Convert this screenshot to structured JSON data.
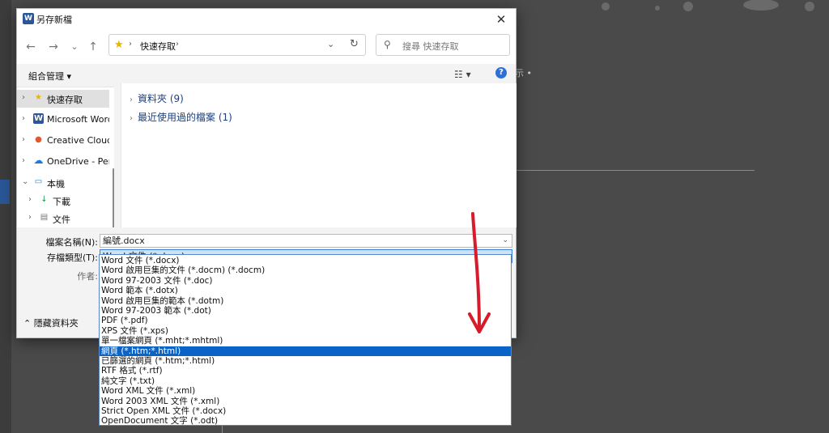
{
  "dialog": {
    "title": "另存新檔",
    "close_glyph": "✕"
  },
  "nav": {
    "back": "←",
    "forward": "→",
    "recent": "⌄",
    "up": "↑",
    "address": {
      "segments": [
        "快速存取"
      ],
      "sep": "›"
    },
    "dropdown_glyph": "⌄",
    "refresh_glyph": "↻",
    "search_placeholder": "搜尋 快速存取"
  },
  "toolbar": {
    "organize": "組合管理 ▾",
    "view_glyph": "☷ ▾",
    "help_glyph": "?"
  },
  "navpane": {
    "items": [
      {
        "label": "快速存取",
        "icon": "★",
        "icon_color": "#e8b400",
        "selected": true
      },
      {
        "label": "Microsoft Word",
        "icon": "W",
        "icon_color": "#2b579a",
        "selected": false
      },
      {
        "label": "Creative Cloud Fi",
        "icon": "●",
        "icon_color": "#e15a2a",
        "selected": false
      },
      {
        "label": "OneDrive - Perso",
        "icon": "☁",
        "icon_color": "#1e78d6",
        "selected": false
      },
      {
        "label": "本機",
        "icon": "▭",
        "icon_color": "#2b7fd0",
        "selected": false
      },
      {
        "label": "下載",
        "icon": "↓",
        "icon_color": "#1a9a4a",
        "selected": false
      },
      {
        "label": "文件",
        "icon": "▤",
        "icon_color": "#7a7a7a",
        "selected": false
      }
    ]
  },
  "content": {
    "groups": [
      {
        "label": "資料夾 (9)"
      },
      {
        "label": "最近使用過的檔案 (1)"
      }
    ]
  },
  "form": {
    "filename_label": "檔案名稱(N):",
    "filename_value": "編號.docx",
    "filetype_label": "存檔類型(T):",
    "filetype_value": "Word 文件 (*.docx)",
    "author_label": "作者:",
    "hide_folders": "⌃  隱藏資料夾"
  },
  "filetype_options": [
    {
      "label": "Word 文件 (*.docx)"
    },
    {
      "label": "Word 啟用巨集的文件 (*.docm) (*.docm)"
    },
    {
      "label": "Word 97-2003 文件 (*.doc)"
    },
    {
      "label": "Word 範本 (*.dotx)"
    },
    {
      "label": "Word 啟用巨集的範本 (*.dotm)"
    },
    {
      "label": "Word 97-2003 範本 (*.dot)"
    },
    {
      "label": "PDF (*.pdf)"
    },
    {
      "label": "XPS 文件 (*.xps)"
    },
    {
      "label": "單一檔案網頁 (*.mht;*.mhtml)"
    },
    {
      "label": "網頁 (*.htm;*.html)"
    },
    {
      "label": "已篩選的網頁 (*.htm;*.html)"
    },
    {
      "label": "RTF 格式 (*.rtf)"
    },
    {
      "label": "純文字 (*.txt)"
    },
    {
      "label": "Word XML 文件 (*.xml)"
    },
    {
      "label": "Word 2003 XML 文件 (*.xml)"
    },
    {
      "label": "Strict Open XML 文件 (*.docx)"
    },
    {
      "label": "OpenDocument 文字 (*.odt)"
    }
  ],
  "filetype_selected_index": 9,
  "background": {
    "hint_text": "示 •"
  },
  "colors": {
    "accent": "#0a64c8",
    "annotation_arrow": "#d81b2a"
  }
}
